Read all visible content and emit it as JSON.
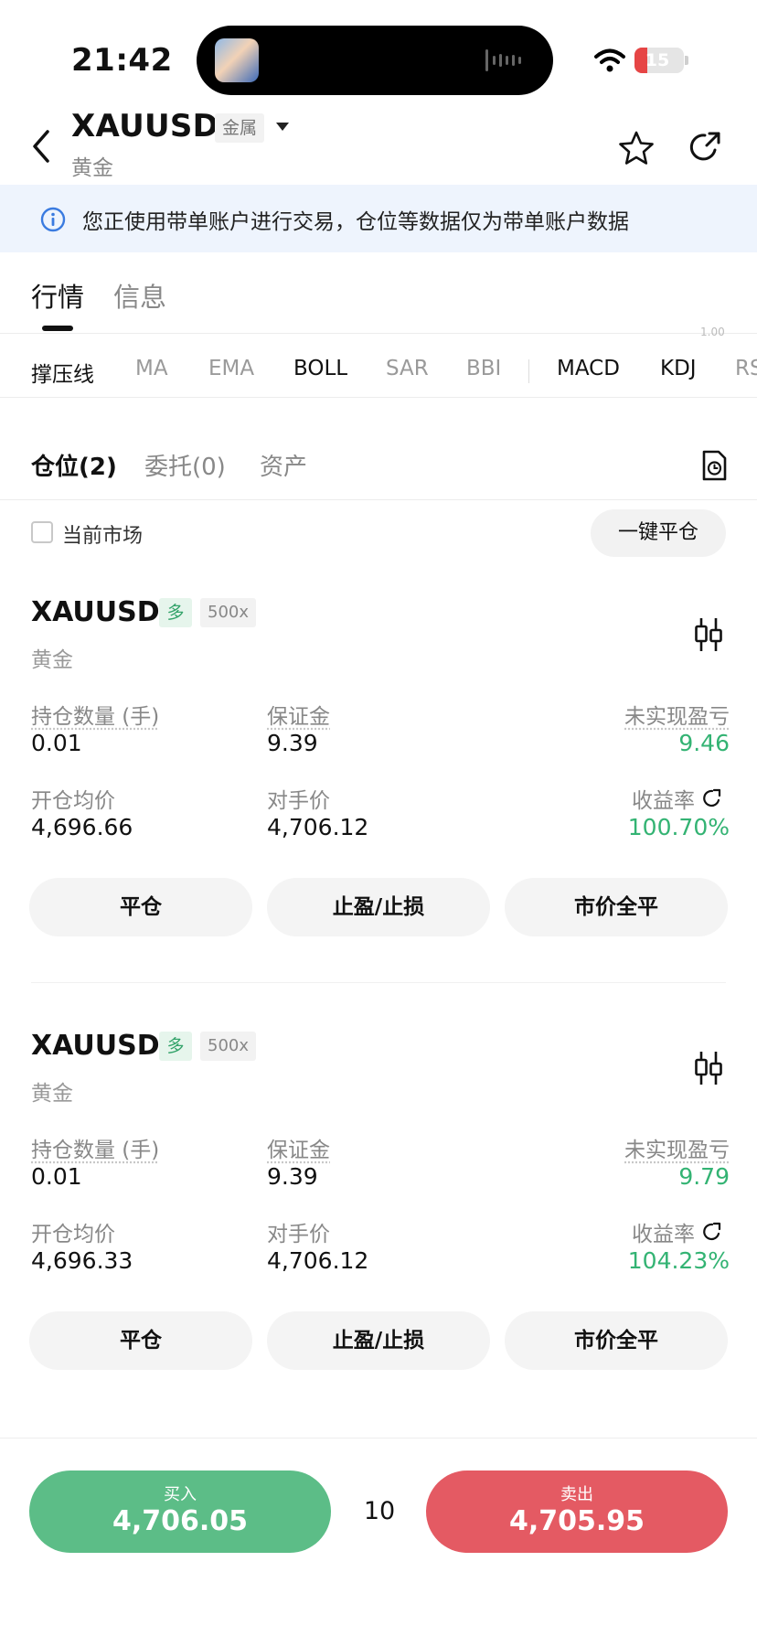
{
  "status": {
    "time": "21:42",
    "battery": "15"
  },
  "header": {
    "symbol": "XAUUSD",
    "category": "金属",
    "name": "黄金"
  },
  "notice": "您正使用带单账户进行交易，仓位等数据仅为带单账户数据",
  "tabs": [
    "行情",
    "信息"
  ],
  "indicators": [
    "撑压线",
    "MA",
    "EMA",
    "BOLL",
    "SAR",
    "BBI",
    "MACD",
    "KDJ",
    "RS"
  ],
  "faint_label": "1.00",
  "section_tabs": [
    "仓位(2)",
    "委托(0)",
    "资产"
  ],
  "filter": {
    "current_market_label": "当前市场",
    "close_all_label": "一键平仓"
  },
  "labels": {
    "quantity": "持仓数量 (手)",
    "margin": "保证金",
    "upnl": "未实现盈亏",
    "avg_open": "开仓均价",
    "counter_price": "对手价",
    "return_rate": "收益率"
  },
  "positions": [
    {
      "symbol": "XAUUSD",
      "side": "多",
      "leverage": "500x",
      "name": "黄金",
      "quantity": "0.01",
      "margin": "9.39",
      "upnl": "9.46",
      "avg_open": "4,696.66",
      "counter_price": "4,706.12",
      "return_rate": "100.70%",
      "actions": [
        "平仓",
        "止盈/止损",
        "市价全平"
      ]
    },
    {
      "symbol": "XAUUSD",
      "side": "多",
      "leverage": "500x",
      "name": "黄金",
      "quantity": "0.01",
      "margin": "9.39",
      "upnl": "9.79",
      "avg_open": "4,696.33",
      "counter_price": "4,706.12",
      "return_rate": "104.23%",
      "actions": [
        "平仓",
        "止盈/止损",
        "市价全平"
      ]
    }
  ],
  "trade_bar": {
    "buy_label": "买入",
    "buy_price": "4,706.05",
    "quantity": "10",
    "sell_label": "卖出",
    "sell_price": "4,705.95"
  },
  "colors": {
    "profit": "#33b373",
    "buy": "#5cbd87",
    "sell": "#e45a63",
    "notice_bg": "#eef4fd"
  }
}
